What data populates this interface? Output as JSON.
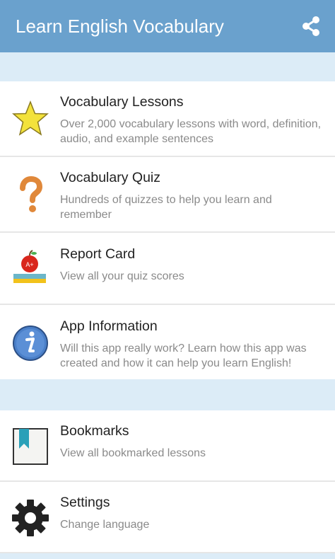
{
  "header": {
    "title": "Learn English Vocabulary",
    "share_icon": "share-icon",
    "background": "#6aa1cd"
  },
  "main_items": [
    {
      "icon": "star-icon",
      "title": "Vocabulary Lessons",
      "description": "Over 2,000 vocabulary lessons with word, definition, audio, and example sentences"
    },
    {
      "icon": "question-mark-icon",
      "title": "Vocabulary Quiz",
      "description": "Hundreds of quizzes to help you learn and remember"
    },
    {
      "icon": "apple-books-icon",
      "title": "Report Card",
      "description": "View all your quiz scores",
      "apple_label": "A+"
    },
    {
      "icon": "info-icon",
      "title": "App Information",
      "description": "Will this app really work? Learn how this app was created and how it can help you learn English!"
    }
  ],
  "secondary_items": [
    {
      "icon": "bookmark-icon",
      "title": "Bookmarks",
      "description": "View all bookmarked lessons"
    },
    {
      "icon": "gear-icon",
      "title": "Settings",
      "description": "Change language"
    }
  ],
  "colors": {
    "section_background": "#dcecf7",
    "title_text": "#222222",
    "description_text": "#8a8a8a"
  }
}
